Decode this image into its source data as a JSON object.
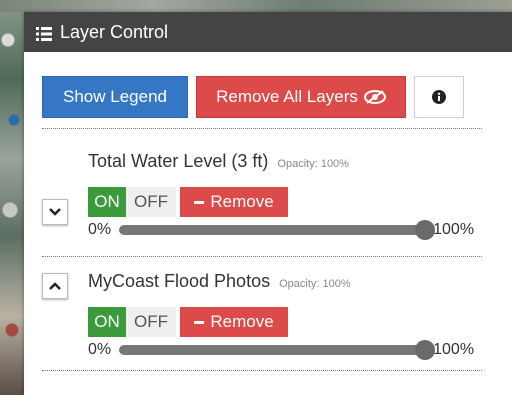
{
  "panel": {
    "title": "Layer Control"
  },
  "buttons": {
    "show_legend": "Show Legend",
    "remove_all": "Remove All Layers",
    "info_icon": "info-circle-icon"
  },
  "layers": [
    {
      "title": "Total Water Level (3 ft)",
      "opacity_text": "Opacity: 100%",
      "expand_icon": "chevron-down-icon",
      "on_label": "ON",
      "off_label": "OFF",
      "state": "ON",
      "remove_label": "Remove",
      "slider_min": "0%",
      "slider_max": "100%",
      "opacity": 1.0
    },
    {
      "title": "MyCoast Flood Photos",
      "opacity_text": "Opacity: 100%",
      "expand_icon": "chevron-up-icon",
      "on_label": "ON",
      "off_label": "OFF",
      "state": "ON",
      "remove_label": "Remove",
      "slider_min": "0%",
      "slider_max": "100%",
      "opacity": 1.0
    }
  ],
  "colors": {
    "header_bg": "#444444",
    "legend_blue": "#3577c4",
    "remove_red": "#dc4a4a",
    "on_green": "#3b9a3b"
  }
}
